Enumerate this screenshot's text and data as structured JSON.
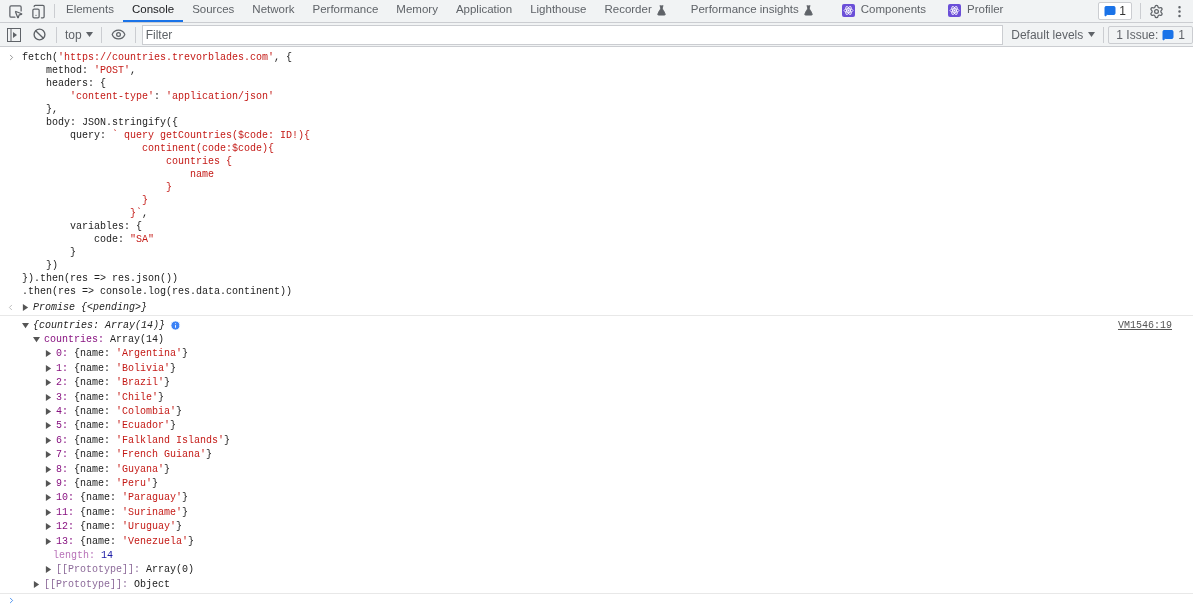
{
  "tabs": [
    {
      "label": "Elements",
      "selected": false,
      "kind": "standard"
    },
    {
      "label": "Console",
      "selected": true,
      "kind": "standard"
    },
    {
      "label": "Sources",
      "selected": false,
      "kind": "standard"
    },
    {
      "label": "Network",
      "selected": false,
      "kind": "standard"
    },
    {
      "label": "Performance",
      "selected": false,
      "kind": "standard"
    },
    {
      "label": "Memory",
      "selected": false,
      "kind": "standard"
    },
    {
      "label": "Application",
      "selected": false,
      "kind": "standard"
    },
    {
      "label": "Lighthouse",
      "selected": false,
      "kind": "standard"
    },
    {
      "label": "Recorder",
      "selected": false,
      "kind": "experimental"
    },
    {
      "label": "Performance insights",
      "selected": false,
      "kind": "experimental"
    },
    {
      "label": "Components",
      "selected": false,
      "kind": "extension"
    },
    {
      "label": "Profiler",
      "selected": false,
      "kind": "extension"
    }
  ],
  "issues_badge": "1",
  "console_toolbar": {
    "context": "top",
    "filter_placeholder": "Filter",
    "levels": "Default levels",
    "issues_label": "1 Issue:",
    "issues_count": "1"
  },
  "input_lines": [
    [
      {
        "text": "fetch(",
        "kind": "plain"
      },
      {
        "text": "'https://countries.trevorblades.com'",
        "kind": "string"
      },
      {
        "text": ", {",
        "kind": "plain"
      }
    ],
    [
      {
        "text": "    method: ",
        "kind": "plain"
      },
      {
        "text": "'POST'",
        "kind": "string"
      },
      {
        "text": ",",
        "kind": "plain"
      }
    ],
    [
      {
        "text": "    headers: {",
        "kind": "plain"
      }
    ],
    [
      {
        "text": "        'content-type'",
        "kind": "string"
      },
      {
        "text": ": ",
        "kind": "plain"
      },
      {
        "text": "'application/json'",
        "kind": "string"
      }
    ],
    [
      {
        "text": "    },",
        "kind": "plain"
      }
    ],
    [
      {
        "text": "    body: JSON.stringify({",
        "kind": "plain"
      }
    ],
    [
      {
        "text": "        query: ",
        "kind": "plain"
      },
      {
        "text": "` query getCountries($code: ID!){",
        "kind": "string"
      }
    ],
    [
      {
        "text": "                    continent(code:$code){",
        "kind": "string"
      }
    ],
    [
      {
        "text": "                        countries {",
        "kind": "string"
      }
    ],
    [
      {
        "text": "                            name",
        "kind": "string"
      }
    ],
    [
      {
        "text": "                        }",
        "kind": "string"
      }
    ],
    [
      {
        "text": "                    }",
        "kind": "string"
      }
    ],
    [
      {
        "text": "                  }`",
        "kind": "string"
      },
      {
        "text": ",",
        "kind": "plain"
      }
    ],
    [
      {
        "text": "        variables: {",
        "kind": "plain"
      }
    ],
    [
      {
        "text": "            code: ",
        "kind": "plain"
      },
      {
        "text": "\"SA\"",
        "kind": "string"
      }
    ],
    [
      {
        "text": "        }",
        "kind": "plain"
      }
    ],
    [
      {
        "text": "    })",
        "kind": "plain"
      }
    ],
    [
      {
        "text": "}).then(res => res.json())",
        "kind": "plain"
      }
    ],
    [
      {
        "text": ".then(res => console.log(res.data.continent))",
        "kind": "plain"
      }
    ]
  ],
  "promise": {
    "text": "Promise {<pending>}",
    "expanded": false
  },
  "log": {
    "summary": "{countries: Array(14)}",
    "expanded": true,
    "source": "VM1546:19",
    "children": [
      {
        "key": "countries:",
        "kind": "enumerable",
        "value": [
          {
            "text": "Array(14)",
            "kind": "plain"
          }
        ],
        "expanded": true,
        "children": [
          {
            "key": "0:",
            "kind": "enumerable",
            "value": [
              {
                "text": "{name: ",
                "kind": "plain"
              },
              {
                "text": "'Argentina'",
                "kind": "string"
              },
              {
                "text": "}",
                "kind": "plain"
              }
            ],
            "expanded": false
          },
          {
            "key": "1:",
            "kind": "enumerable",
            "value": [
              {
                "text": "{name: ",
                "kind": "plain"
              },
              {
                "text": "'Bolivia'",
                "kind": "string"
              },
              {
                "text": "}",
                "kind": "plain"
              }
            ],
            "expanded": false
          },
          {
            "key": "2:",
            "kind": "enumerable",
            "value": [
              {
                "text": "{name: ",
                "kind": "plain"
              },
              {
                "text": "'Brazil'",
                "kind": "string"
              },
              {
                "text": "}",
                "kind": "plain"
              }
            ],
            "expanded": false
          },
          {
            "key": "3:",
            "kind": "enumerable",
            "value": [
              {
                "text": "{name: ",
                "kind": "plain"
              },
              {
                "text": "'Chile'",
                "kind": "string"
              },
              {
                "text": "}",
                "kind": "plain"
              }
            ],
            "expanded": false
          },
          {
            "key": "4:",
            "kind": "enumerable",
            "value": [
              {
                "text": "{name: ",
                "kind": "plain"
              },
              {
                "text": "'Colombia'",
                "kind": "string"
              },
              {
                "text": "}",
                "kind": "plain"
              }
            ],
            "expanded": false
          },
          {
            "key": "5:",
            "kind": "enumerable",
            "value": [
              {
                "text": "{name: ",
                "kind": "plain"
              },
              {
                "text": "'Ecuador'",
                "kind": "string"
              },
              {
                "text": "}",
                "kind": "plain"
              }
            ],
            "expanded": false
          },
          {
            "key": "6:",
            "kind": "enumerable",
            "value": [
              {
                "text": "{name: ",
                "kind": "plain"
              },
              {
                "text": "'Falkland Islands'",
                "kind": "string"
              },
              {
                "text": "}",
                "kind": "plain"
              }
            ],
            "expanded": false
          },
          {
            "key": "7:",
            "kind": "enumerable",
            "value": [
              {
                "text": "{name: ",
                "kind": "plain"
              },
              {
                "text": "'French Guiana'",
                "kind": "string"
              },
              {
                "text": "}",
                "kind": "plain"
              }
            ],
            "expanded": false
          },
          {
            "key": "8:",
            "kind": "enumerable",
            "value": [
              {
                "text": "{name: ",
                "kind": "plain"
              },
              {
                "text": "'Guyana'",
                "kind": "string"
              },
              {
                "text": "}",
                "kind": "plain"
              }
            ],
            "expanded": false
          },
          {
            "key": "9:",
            "kind": "enumerable",
            "value": [
              {
                "text": "{name: ",
                "kind": "plain"
              },
              {
                "text": "'Peru'",
                "kind": "string"
              },
              {
                "text": "}",
                "kind": "plain"
              }
            ],
            "expanded": false
          },
          {
            "key": "10:",
            "kind": "enumerable",
            "value": [
              {
                "text": "{name: ",
                "kind": "plain"
              },
              {
                "text": "'Paraguay'",
                "kind": "string"
              },
              {
                "text": "}",
                "kind": "plain"
              }
            ],
            "expanded": false
          },
          {
            "key": "11:",
            "kind": "enumerable",
            "value": [
              {
                "text": "{name: ",
                "kind": "plain"
              },
              {
                "text": "'Suriname'",
                "kind": "string"
              },
              {
                "text": "}",
                "kind": "plain"
              }
            ],
            "expanded": false
          },
          {
            "key": "12:",
            "kind": "enumerable",
            "value": [
              {
                "text": "{name: ",
                "kind": "plain"
              },
              {
                "text": "'Uruguay'",
                "kind": "string"
              },
              {
                "text": "}",
                "kind": "plain"
              }
            ],
            "expanded": false
          },
          {
            "key": "13:",
            "kind": "enumerable",
            "value": [
              {
                "text": "{name: ",
                "kind": "plain"
              },
              {
                "text": "'Venezuela'",
                "kind": "string"
              },
              {
                "text": "}",
                "kind": "plain"
              }
            ],
            "expanded": false
          },
          {
            "key": "length:",
            "kind": "non_enumerable",
            "value": [
              {
                "text": "14",
                "kind": "number"
              }
            ]
          },
          {
            "key": "[[Prototype]]:",
            "kind": "internal",
            "value": [
              {
                "text": "Array(0)",
                "kind": "plain"
              }
            ],
            "expanded": false
          }
        ]
      },
      {
        "key": "[[Prototype]]:",
        "kind": "internal",
        "value": [
          {
            "text": "Object",
            "kind": "plain"
          }
        ],
        "expanded": false
      }
    ]
  }
}
